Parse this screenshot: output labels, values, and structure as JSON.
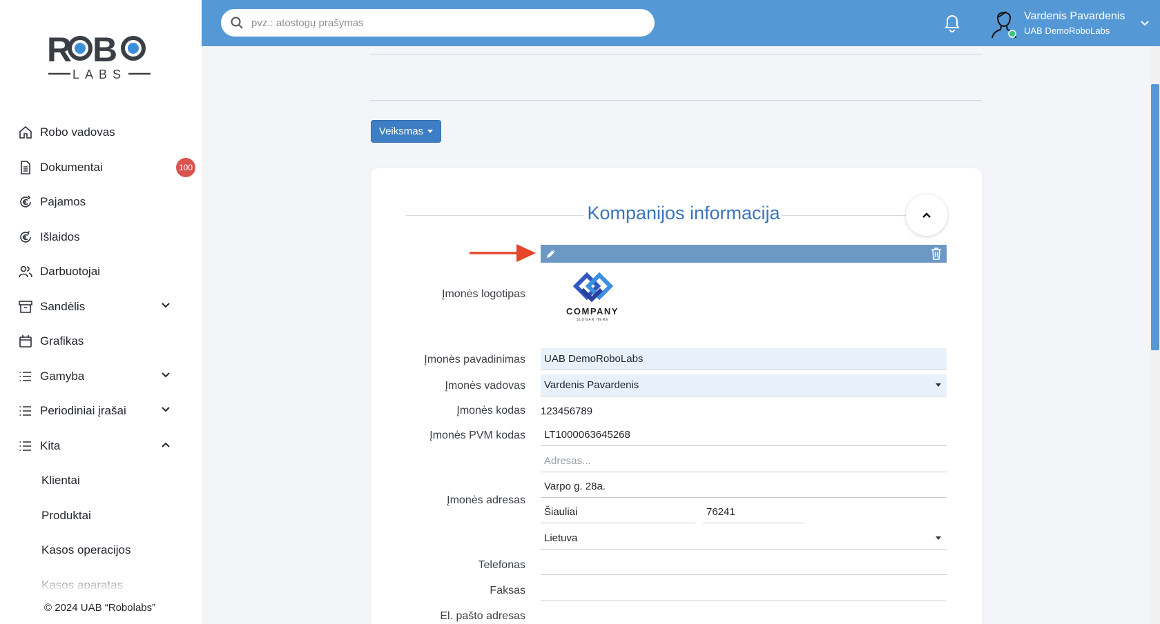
{
  "brand": {
    "logo_text_top": "ROBO",
    "logo_text_bottom": "LABS"
  },
  "colors": {
    "primary": "#5598d6",
    "button": "#3d7ec4",
    "title": "#3b74b9",
    "badge": "#d9534f",
    "field_bg": "#e8f1fb",
    "annotation_arrow": "#e8442a"
  },
  "search": {
    "placeholder": "pvz.: atostogų prašymas"
  },
  "user": {
    "name": "Vardenis Pavardenis",
    "company": "UAB DemoRoboLabs"
  },
  "sidebar": {
    "items": [
      {
        "label": "Robo vadovas",
        "icon": "home-icon"
      },
      {
        "label": "Dokumentai",
        "icon": "document-icon",
        "badge": "100"
      },
      {
        "label": "Pajamos",
        "icon": "euro-income-icon"
      },
      {
        "label": "Išlaidos",
        "icon": "euro-expense-icon"
      },
      {
        "label": "Darbuotojai",
        "icon": "users-icon"
      },
      {
        "label": "Sandėlis",
        "icon": "archive-icon",
        "expandable": true
      },
      {
        "label": "Grafikas",
        "icon": "calendar-icon"
      },
      {
        "label": "Gamyba",
        "icon": "list-icon",
        "expandable": true
      },
      {
        "label": "Periodiniai įrašai",
        "icon": "list-icon",
        "expandable": true
      },
      {
        "label": "Kita",
        "icon": "list-icon",
        "expanded": true
      }
    ],
    "sub_items": [
      "Klientai",
      "Produktai",
      "Kasos operacijos",
      "Kasos aparatas"
    ],
    "copyright": "© 2024 UAB “Robolabs”"
  },
  "toolbar": {
    "action_label": "Veiksmas"
  },
  "card": {
    "title": "Kompanijos informacija",
    "logo_label": "Įmonės logotipas",
    "company_logo_text": "COMPANY",
    "company_logo_slogan": "SLOGAN HERE",
    "fields": {
      "name_label": "Įmonės pavadinimas",
      "name_value": "UAB DemoRoboLabs",
      "manager_label": "Įmonės vadovas",
      "manager_value": "Vardenis Pavardenis",
      "code_label": "Įmonės kodas",
      "code_value": "123456789",
      "vat_label": "Įmonės PVM kodas",
      "vat_value": "LT1000063645268",
      "address_label": "Įmonės adresas",
      "address_placeholder": "Adresas...",
      "street_value": "Varpo g. 28a.",
      "city_value": "Šiauliai",
      "zip_value": "76241",
      "country_value": "Lietuva",
      "phone_label": "Telefonas",
      "phone_value": "",
      "fax_label": "Faksas",
      "fax_value": "",
      "email_label": "El. pašto adresas"
    }
  }
}
